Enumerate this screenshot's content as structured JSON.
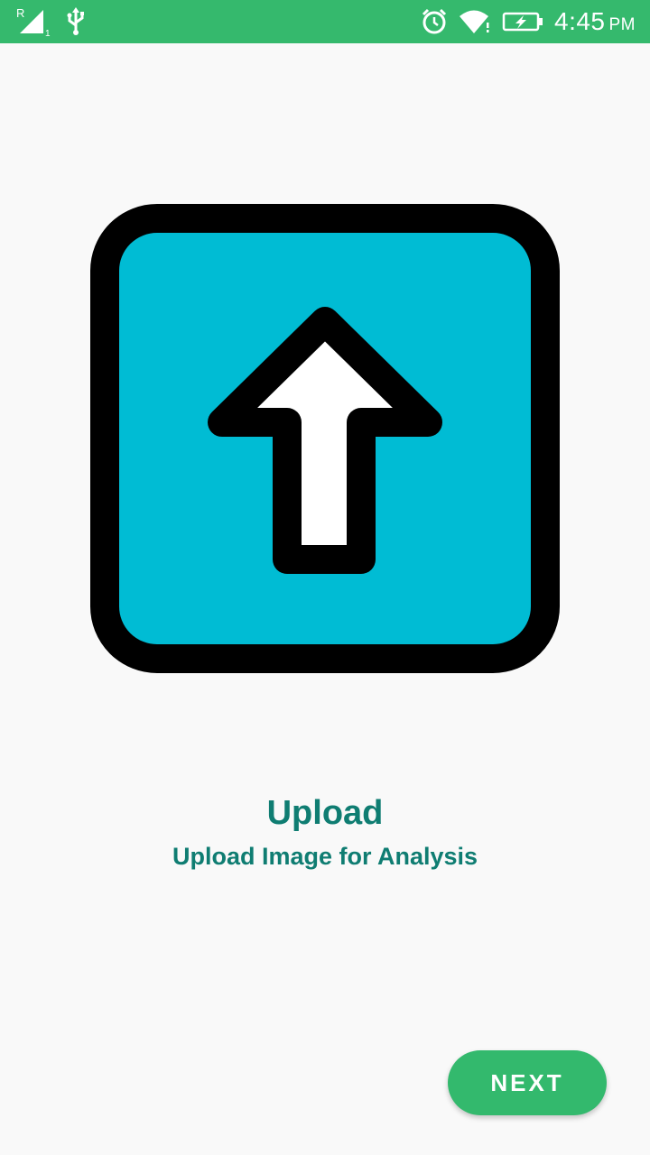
{
  "status_bar": {
    "time": "4:45",
    "ampm": "PM",
    "signal_label": "R",
    "sim_slot": "1",
    "icons": [
      "signal-icon",
      "usb-icon",
      "alarm-icon",
      "wifi-icon",
      "battery-charging-icon"
    ],
    "color": "#35b96d"
  },
  "hero": {
    "icon": "upload-arrow-icon",
    "frame_color": "#000000",
    "fill_color": "#00bcd4",
    "arrow_color": "#ffffff"
  },
  "content": {
    "title": "Upload",
    "subtitle": "Upload Image for Analysis",
    "text_color": "#0f7d72"
  },
  "footer": {
    "next_label": "NEXT",
    "button_color": "#33b96d"
  }
}
